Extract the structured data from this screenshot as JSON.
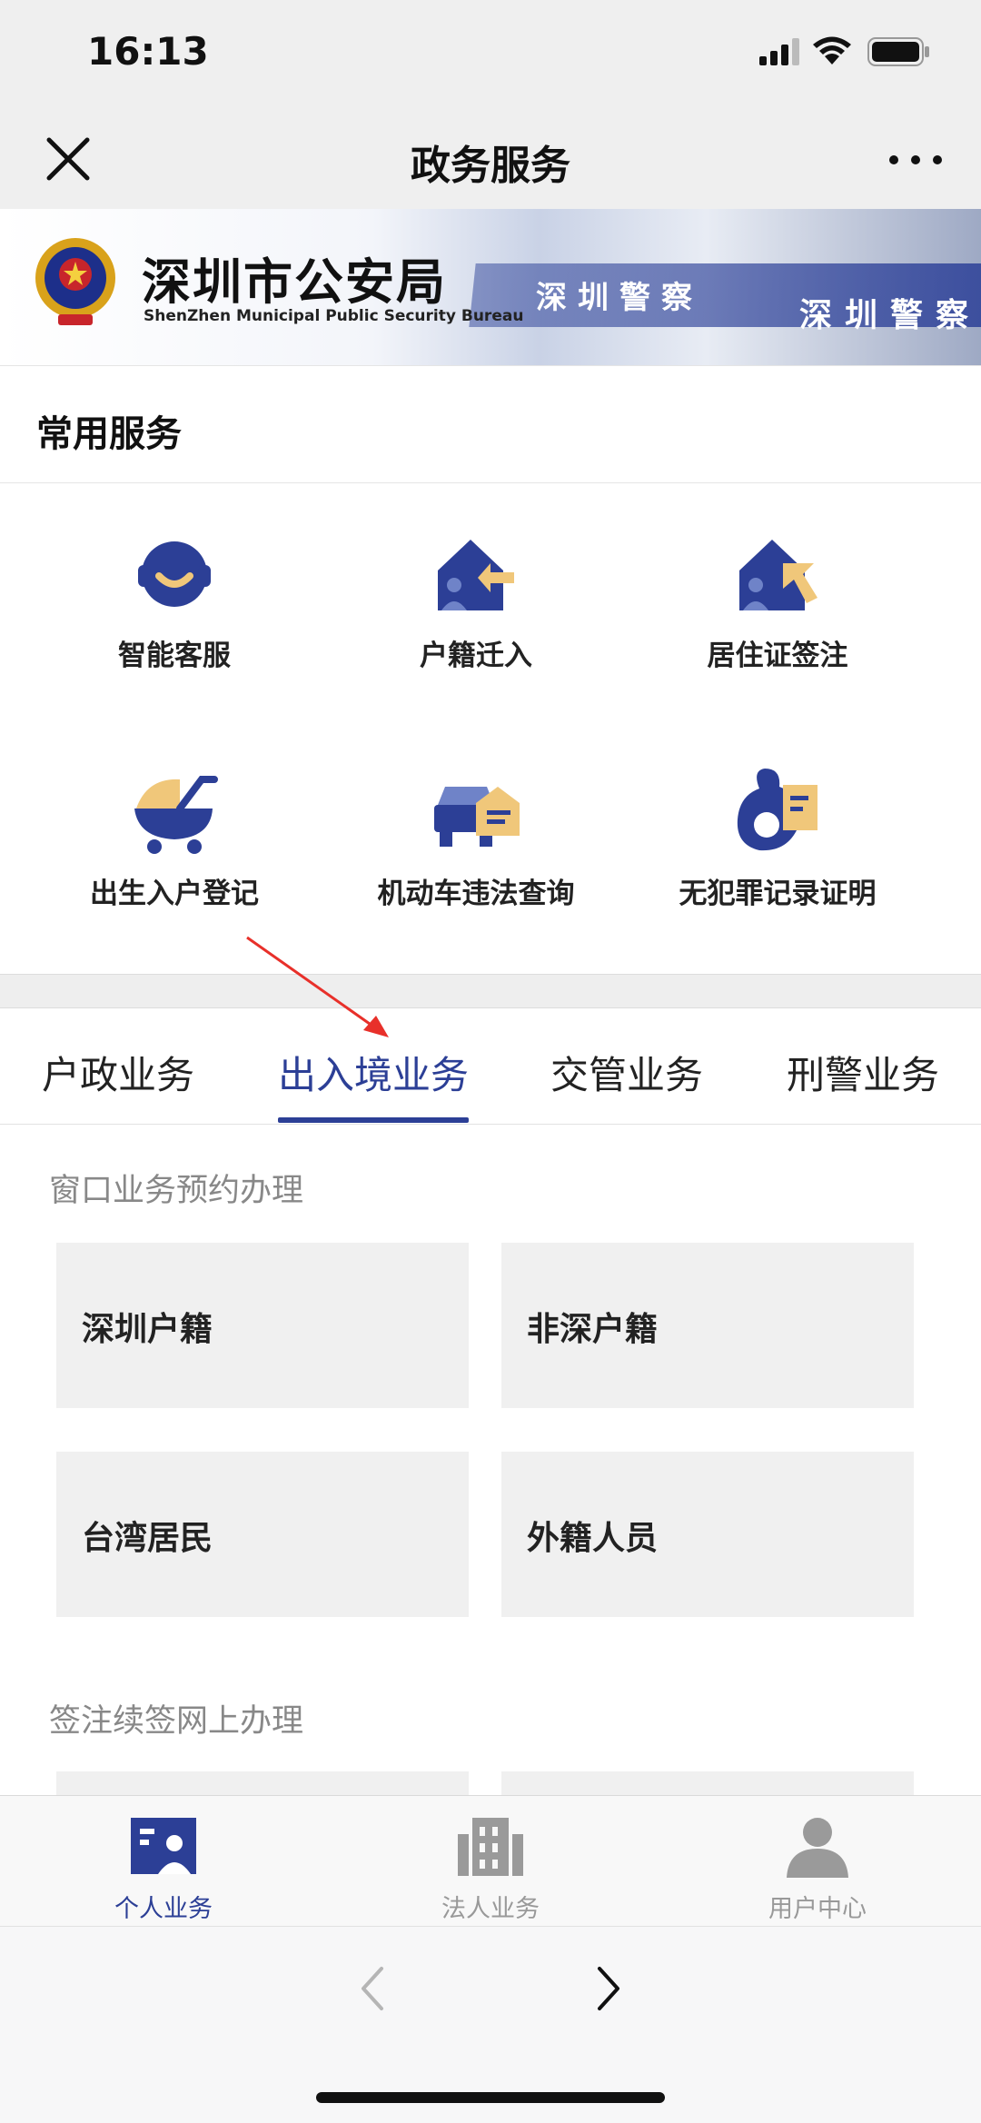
{
  "status_bar": {
    "time": "16:13"
  },
  "nav": {
    "title": "政务服务"
  },
  "banner": {
    "title": "深圳市公安局",
    "subtitle": "ShenZhen Municipal Public Security Bureau",
    "sign_text_left": "深圳警察",
    "sign_text_right": "深圳警察"
  },
  "common_services": {
    "title": "常用服务",
    "items": [
      {
        "label": "智能客服",
        "icon": "customer-service-icon"
      },
      {
        "label": "户籍迁入",
        "icon": "household-move-in-icon"
      },
      {
        "label": "居住证签注",
        "icon": "residence-permit-icon"
      },
      {
        "label": "出生入户登记",
        "icon": "birth-registration-icon"
      },
      {
        "label": "机动车违法查询",
        "icon": "vehicle-violation-icon"
      },
      {
        "label": "无犯罪记录证明",
        "icon": "no-criminal-record-icon"
      }
    ]
  },
  "tabs": [
    {
      "label": "户政业务"
    },
    {
      "label": "出入境业务"
    },
    {
      "label": "交管业务"
    },
    {
      "label": "刑警业务"
    }
  ],
  "active_tab": "出入境业务",
  "window_booking": {
    "title": "窗口业务预约办理",
    "cards": [
      {
        "label": "深圳户籍"
      },
      {
        "label": "非深户籍"
      },
      {
        "label": "台湾居民"
      },
      {
        "label": "外籍人员"
      }
    ]
  },
  "online_renewal": {
    "title": "签注续签网上办理"
  },
  "tabbar": [
    {
      "label": "个人业务",
      "icon": "personal-business-icon"
    },
    {
      "label": "法人业务",
      "icon": "corporate-business-icon"
    },
    {
      "label": "用户中心",
      "icon": "user-center-icon"
    }
  ],
  "colors": {
    "brand_blue": "#2c3f96",
    "icon_gold": "#f0c77a",
    "annotation_red": "#e8302a"
  }
}
